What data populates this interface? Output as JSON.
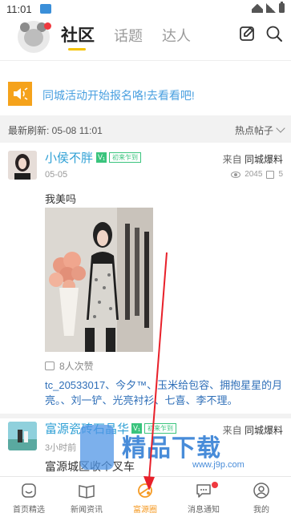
{
  "status_bar": {
    "time": "11:01"
  },
  "header": {
    "tabs": [
      {
        "label": "社区"
      },
      {
        "label": "话题"
      },
      {
        "label": "达人"
      }
    ]
  },
  "notice": {
    "text": "同城活动开始报名咯!去看看吧!"
  },
  "refresh": {
    "text": "最新刷新: 05-08 11:01",
    "sort_label": "热点帖子"
  },
  "posts": [
    {
      "user": "小侯不胖",
      "v_badge": "V₁",
      "level_badge": "初来乍到",
      "date": "05-05",
      "source_prefix": "来自",
      "source_name": "同城爆料",
      "views": "2045",
      "comments": "5",
      "text": "我美吗",
      "likes": "8人次赞",
      "likers": "tc_20533017、今夕™、玉米给包容、拥抱星星的月亮。、刘一铲、光亮衬衫、七喜、李不理。"
    },
    {
      "user": "富源瓷砖石晶华",
      "v_badge": "V₁",
      "level_badge": "初来乍到",
      "date": "3小时前",
      "source_prefix": "来自",
      "source_name": "同城爆料",
      "text": "富源城区收个叉车"
    }
  ],
  "tabbar": {
    "items": [
      {
        "label": "首页精选"
      },
      {
        "label": "新闻资讯"
      },
      {
        "label": "富源圈"
      },
      {
        "label": "消息通知"
      },
      {
        "label": "我的"
      }
    ]
  },
  "watermark": {
    "brand": "精品下载",
    "url": "www.j9p.com"
  },
  "colors": {
    "accent": "#f5c200",
    "link": "#2fa0d5",
    "notice_icon": "#f5a21b",
    "annotation_arrow": "#e8202a"
  }
}
